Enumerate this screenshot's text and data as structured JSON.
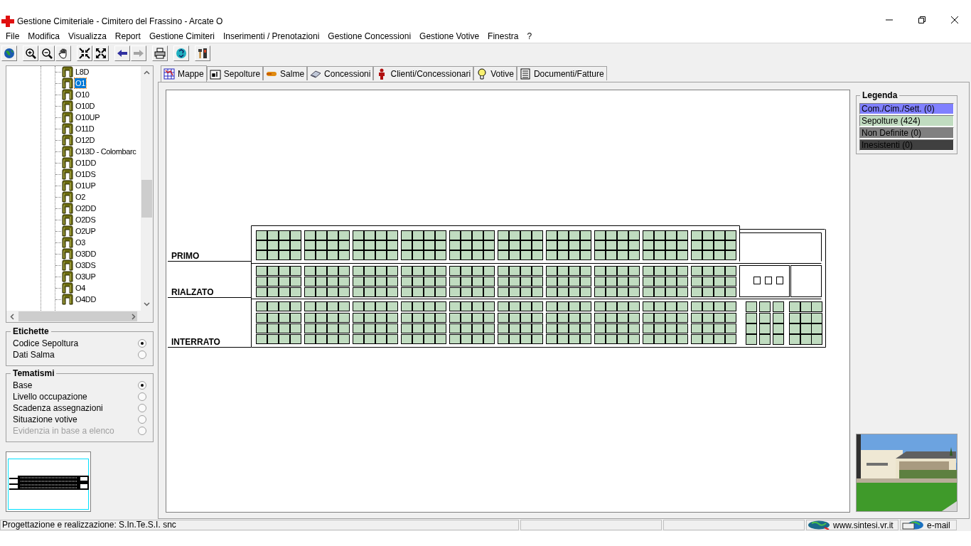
{
  "window": {
    "title": "Gestione Cimiteriale - Cimitero del Frassino - Arcate O"
  },
  "menu": [
    "File",
    "Modifica",
    "Visualizza",
    "Report",
    "Gestione Cimiteri",
    "Inserimenti / Prenotazioni",
    "Gestione Concessioni",
    "Gestione Votive",
    "Finestra",
    "?"
  ],
  "toolbar": [
    [
      {
        "kind": "globe",
        "disabled": false
      }
    ],
    [
      {
        "kind": "zoomin",
        "disabled": false
      },
      {
        "kind": "zoomout",
        "disabled": false
      },
      {
        "kind": "pan",
        "disabled": false
      }
    ],
    [
      {
        "kind": "shrink",
        "disabled": false
      },
      {
        "kind": "expand",
        "disabled": false
      }
    ],
    [
      {
        "kind": "back",
        "disabled": false
      },
      {
        "kind": "forward",
        "disabled": true
      }
    ],
    [
      {
        "kind": "print",
        "disabled": false
      }
    ],
    [
      {
        "kind": "refresh",
        "disabled": false
      }
    ],
    [
      {
        "kind": "tools",
        "disabled": false
      }
    ]
  ],
  "tree": {
    "items": [
      {
        "label": "L8D",
        "selected": false
      },
      {
        "label": "O1",
        "selected": true
      },
      {
        "label": "O10",
        "selected": false
      },
      {
        "label": "O10D",
        "selected": false
      },
      {
        "label": "O10UP",
        "selected": false
      },
      {
        "label": "O11D",
        "selected": false
      },
      {
        "label": "O12D",
        "selected": false
      },
      {
        "label": "O13D - Colombarc",
        "selected": false
      },
      {
        "label": "O1DD",
        "selected": false
      },
      {
        "label": "O1DS",
        "selected": false
      },
      {
        "label": "O1UP",
        "selected": false
      },
      {
        "label": "O2",
        "selected": false
      },
      {
        "label": "O2DD",
        "selected": false
      },
      {
        "label": "O2DS",
        "selected": false
      },
      {
        "label": "O2UP",
        "selected": false
      },
      {
        "label": "O3",
        "selected": false
      },
      {
        "label": "O3DD",
        "selected": false
      },
      {
        "label": "O3DS",
        "selected": false
      },
      {
        "label": "O3UP",
        "selected": false
      },
      {
        "label": "O4",
        "selected": false
      },
      {
        "label": "O4DD",
        "selected": false
      }
    ]
  },
  "etichette": {
    "title": "Etichette",
    "options": [
      {
        "label": "Codice Sepoltura",
        "selected": true,
        "disabled": false
      },
      {
        "label": "Dati Salma",
        "selected": false,
        "disabled": false
      }
    ]
  },
  "tematismi": {
    "title": "Tematismi",
    "options": [
      {
        "label": "Base",
        "selected": true,
        "disabled": false
      },
      {
        "label": "Livello occupazione",
        "selected": false,
        "disabled": false
      },
      {
        "label": "Scadenza assegnazioni",
        "selected": false,
        "disabled": false
      },
      {
        "label": "Situazione votive",
        "selected": false,
        "disabled": false
      },
      {
        "label": "Evidenzia in base a elenco",
        "selected": false,
        "disabled": true
      }
    ]
  },
  "tabs": [
    {
      "kind": "map",
      "label": "Mappe",
      "selected": true
    },
    {
      "kind": "grave",
      "label": "Sepolture",
      "selected": false
    },
    {
      "kind": "body",
      "label": "Salme",
      "selected": false
    },
    {
      "kind": "deed",
      "label": "Concessioni",
      "selected": false
    },
    {
      "kind": "person",
      "label": "Clienti/Concessionari",
      "selected": false
    },
    {
      "kind": "bulb",
      "label": "Votive",
      "selected": false
    },
    {
      "kind": "doc",
      "label": "Documenti/Fatture",
      "selected": false
    }
  ],
  "map": {
    "floors": [
      {
        "label": "PRIMO"
      },
      {
        "label": "RIALZATO"
      },
      {
        "label": "INTERRATO"
      }
    ]
  },
  "legend": {
    "title": "Legenda",
    "items": [
      {
        "label": "Com./Cim./Sett. (0)",
        "color": "#8080ff"
      },
      {
        "label": "Sepolture (424)",
        "color": "#c0dcc0"
      },
      {
        "label": "Non Definite (0)",
        "color": "#808080"
      },
      {
        "label": "Inesistenti (0)",
        "color": "#404040"
      }
    ]
  },
  "status_bar": {
    "credit": "Progettazione e realizzazione: S.In.Te.S.I. snc",
    "website": "www.sintesi.vr.it",
    "email": "e-mail"
  }
}
